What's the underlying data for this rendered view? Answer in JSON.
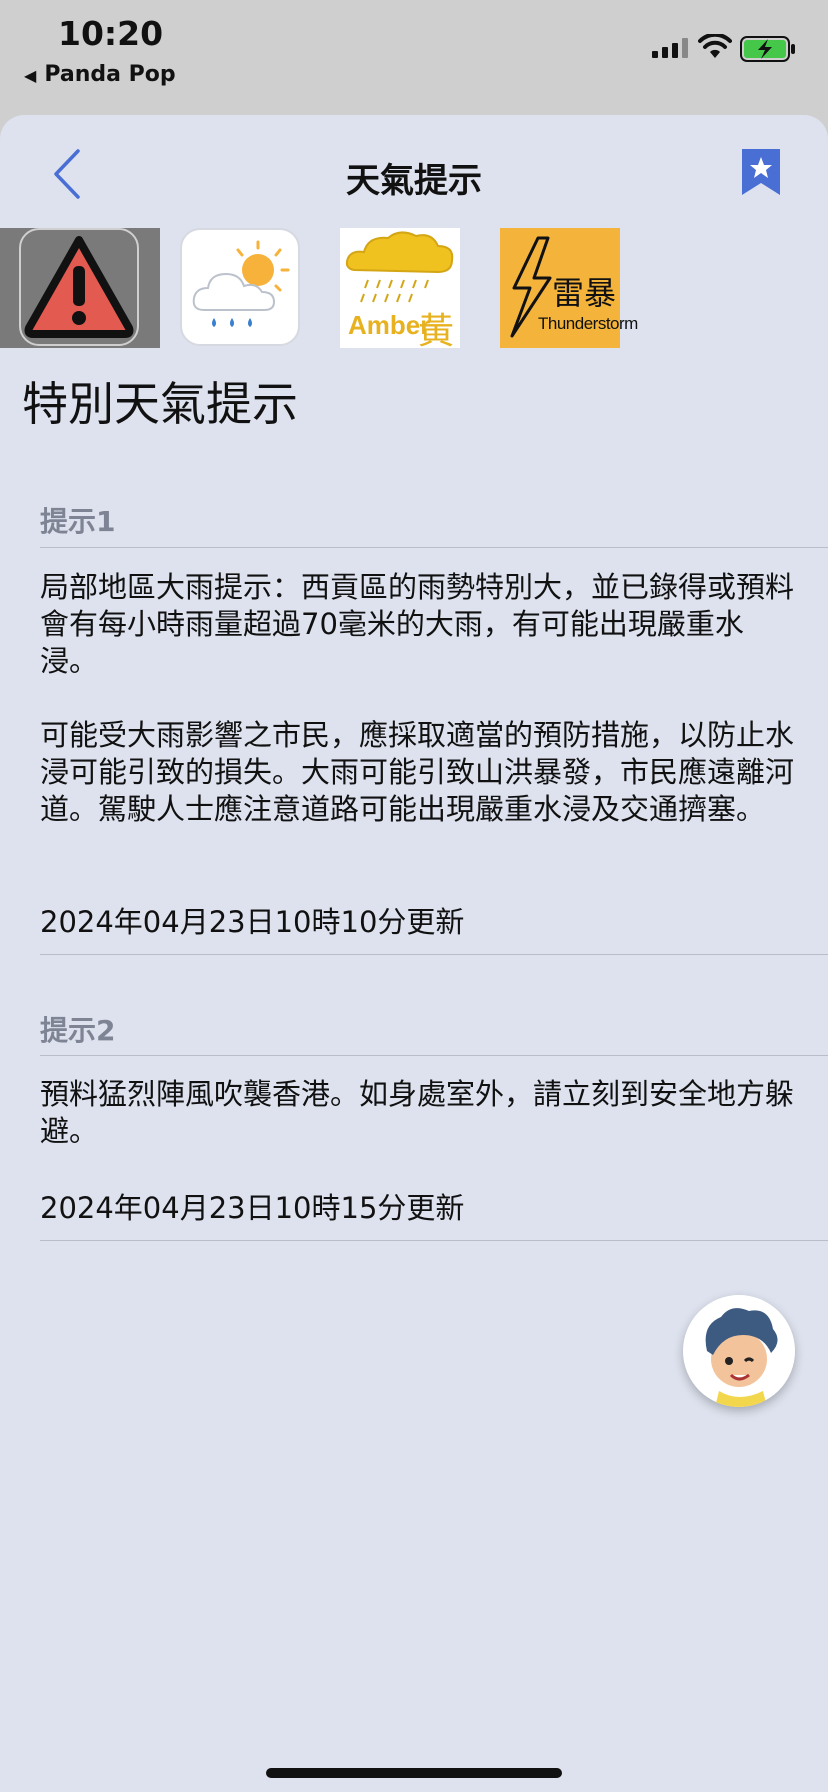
{
  "status_bar": {
    "time": "10:20",
    "back_app_label": "Panda Pop"
  },
  "nav": {
    "title": "天氣提示"
  },
  "warning_icons": {
    "amber_en": "Amber",
    "amber_zh": "黃",
    "thunder_zh": "雷暴",
    "thunder_en": "Thunderstorm"
  },
  "page_heading": "特別天氣提示",
  "alerts": [
    {
      "label": "提示1",
      "paragraphs": [
        "局部地區大雨提示：西貢區的雨勢特別大，並已錄得或預料會有每小時雨量超過70毫米的大雨，有可能出現嚴重水浸。",
        "可能受大雨影響之市民，應採取適當的預防措施，以防止水浸可能引致的損失。大雨可能引致山洪暴發，市民應遠離河道。駕駛人士應注意道路可能出現嚴重水浸及交通擠塞。"
      ],
      "updated": "2024年04月23日10時10分更新"
    },
    {
      "label": "提示2",
      "paragraphs": [
        "預料猛烈陣風吹襲香港。如身處室外，請立刻到安全地方躲避。"
      ],
      "updated": "2024年04月23日10時15分更新"
    }
  ],
  "colors": {
    "background": "#dde2ee",
    "accent": "#4a6fd4",
    "label_gray": "#7f8494"
  }
}
